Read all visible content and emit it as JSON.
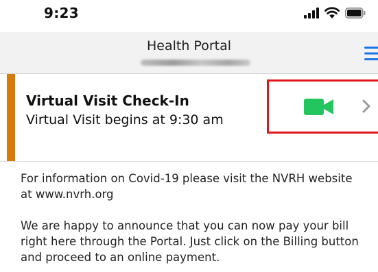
{
  "status_bar": {
    "time": "9:23",
    "icons": [
      "signal-icon",
      "wifi-icon",
      "battery-icon"
    ]
  },
  "header": {
    "title": "Health Portal",
    "subtitle_redacted": true,
    "menu_icon": "hamburger-menu-icon"
  },
  "visit_card": {
    "title": "Virtual Visit Check-In",
    "subtitle": "Virtual Visit begins at 9:30 am",
    "accent_color": "#d97a0c",
    "video_icon": "video-camera-icon",
    "video_icon_color": "#22c55e",
    "chevron_icon": "chevron-right-icon",
    "highlight_color": "#e0141b"
  },
  "content": {
    "paragraphs": [
      "For information on Covid-19 please visit the NVRH website at www.nvrh.org",
      "We are happy to announce that you can now pay your bill right here through the Portal. Just click on the Billing button and proceed to an online payment."
    ]
  },
  "colors": {
    "header_bg": "#f2f2f2",
    "menu_icon": "#1a73e8"
  }
}
